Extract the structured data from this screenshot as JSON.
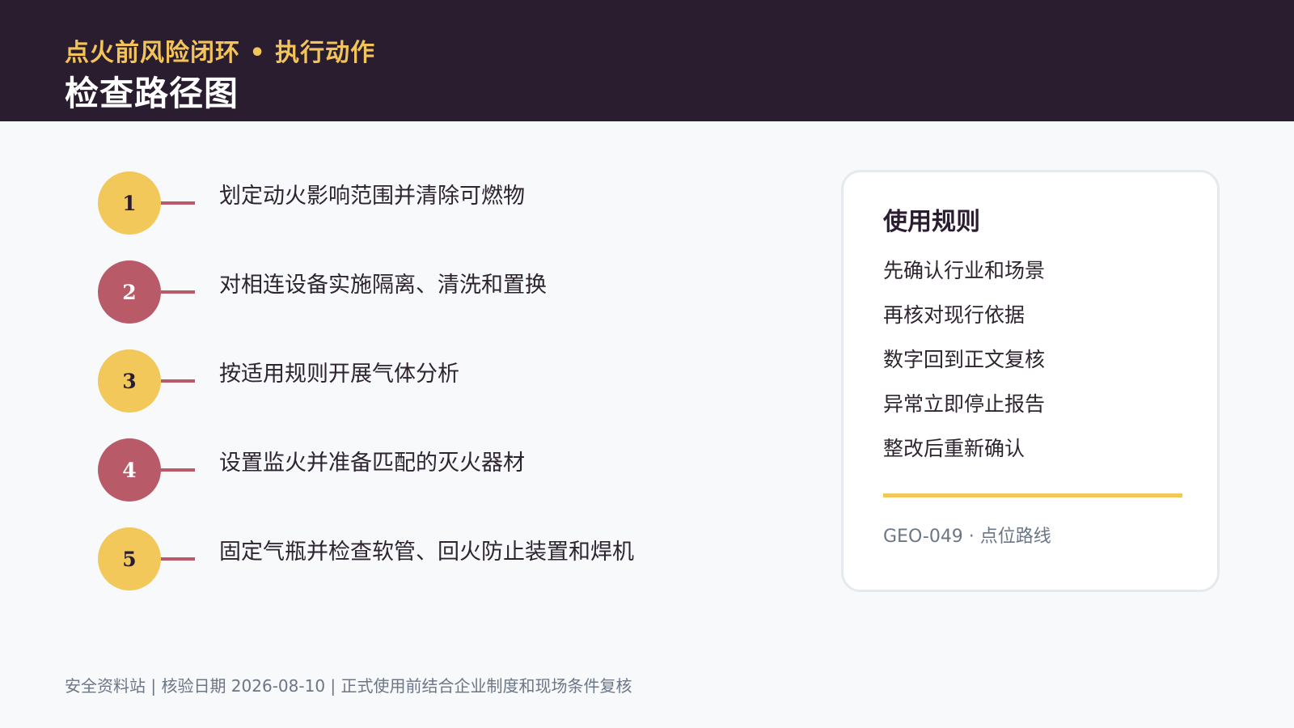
{
  "header": {
    "subtitle": "点火前风险闭环 • 执行动作",
    "title": "检查路径图"
  },
  "steps": [
    {
      "number": "1",
      "label": "划定动火影响范围并清除可燃物",
      "color": "#f2c85a"
    },
    {
      "number": "2",
      "label": "对相连设备实施隔离、清洗和置换",
      "color": "#b95a68"
    },
    {
      "number": "3",
      "label": "按适用规则开展气体分析",
      "color": "#f2c85a"
    },
    {
      "number": "4",
      "label": "设置监火并准备匹配的灭火器材",
      "color": "#b95a68"
    },
    {
      "number": "5",
      "label": "固定气瓶并检查软管、回火防止装置和焊机",
      "color": "#f2c85a"
    }
  ],
  "card": {
    "title": "使用规则",
    "rules": [
      "先确认行业和场景",
      "再核对现行依据",
      "数字回到正文复核",
      "异常立即停止报告",
      "整改后重新确认"
    ],
    "code": "GEO-049 · 点位路线"
  },
  "footer": {
    "text": "安全资料站 | 核验日期 2026-08-10 | 正式使用前结合企业制度和现场条件复核"
  },
  "colors": {
    "header_bg": "#2b1d30",
    "accent_gold": "#f2c85a",
    "accent_rose": "#b95a68"
  }
}
